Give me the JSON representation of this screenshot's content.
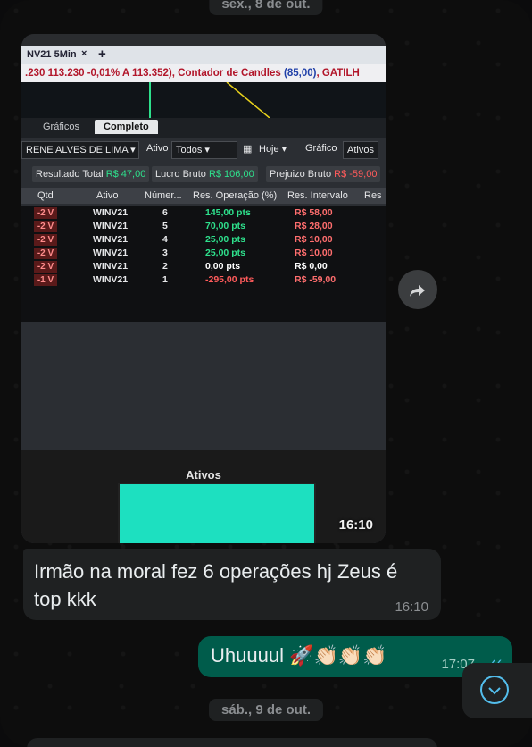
{
  "chat": {
    "date_top": "sex., 8 de out.",
    "date_bottom": "sáb., 9 de out.",
    "image_message": {
      "time": "16:10"
    },
    "incoming_message": {
      "text": "Irmão na moral fez 6 operações hj Zeus é top kkk",
      "time": "16:10"
    },
    "outgoing_message": {
      "text": "Uhuuuul 🚀👏🏻👏🏻👏🏻",
      "time": "17:07",
      "status": "read"
    }
  },
  "photo": {
    "tab_label": "NV21 5Min",
    "tab_close": "×",
    "tab_plus": "+",
    "ticker_part1": ".230  113.230  -0,01%  A 113.352), Contador de Candles ",
    "ticker_part2": "(85,00)",
    "ticker_part3": ", GATILH",
    "subtab_graficos": "Gráficos",
    "subtab_completo": "Completo",
    "account": "RENE ALVES DE LIMA",
    "ativo_label": "Ativo",
    "ativo_value": "Todos",
    "period": "Hoje",
    "grafico_label": "Gráfico",
    "ativos_label": "Ativos",
    "resultado_label": "Resultado Total",
    "resultado_value": "R$ 47,00",
    "lucro_label": "Lucro Bruto",
    "lucro_value": "R$ 106,00",
    "prejuizo_label": "Prejuizo Bruto",
    "prejuizo_value": "R$ -59,00",
    "headers": [
      "Qtd",
      "Ativo",
      "Númer...",
      "Res. Operação (%)",
      "Res. Intervalo",
      "Res"
    ],
    "rows": [
      {
        "qtd": "-2 V",
        "ativo": "WINV21",
        "num": "6",
        "op": "145,00 pts",
        "intervalo": "R$ 58,00",
        "op_color": "green"
      },
      {
        "qtd": "-2 V",
        "ativo": "WINV21",
        "num": "5",
        "op": "70,00 pts",
        "intervalo": "R$ 28,00",
        "op_color": "green"
      },
      {
        "qtd": "-2 V",
        "ativo": "WINV21",
        "num": "4",
        "op": "25,00 pts",
        "intervalo": "R$ 10,00",
        "op_color": "green"
      },
      {
        "qtd": "-2 V",
        "ativo": "WINV21",
        "num": "3",
        "op": "25,00 pts",
        "intervalo": "R$ 10,00",
        "op_color": "green"
      },
      {
        "qtd": "-2 V",
        "ativo": "WINV21",
        "num": "2",
        "op": "0,00 pts",
        "intervalo": "R$ 0,00",
        "op_color": "white"
      },
      {
        "qtd": "-1 V",
        "ativo": "WINV21",
        "num": "1",
        "op": "-295,00 pts",
        "intervalo": "R$ -59,00",
        "op_color": "red"
      }
    ],
    "bottom_title": "Ativos"
  },
  "icons": {
    "forward": "forward-arrow-icon",
    "scroll_down": "chevron-down-icon",
    "read_ticks": "double-check-icon"
  },
  "colors": {
    "incoming_bubble": "#1f2122",
    "outgoing_bubble": "#005c4b",
    "read_tick": "#53bdeb"
  }
}
